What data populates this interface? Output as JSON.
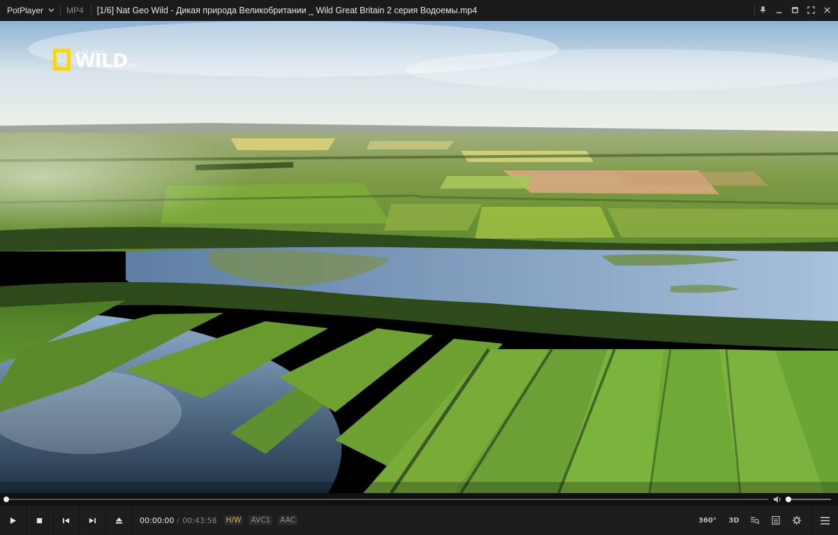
{
  "titlebar": {
    "app_name": "PotPlayer",
    "format": "MP4",
    "title": "[1/6] Nat Geo Wild - Дикая природа Великобритании _ Wild Great Britain 2 серия  Водоемы.mp4"
  },
  "video": {
    "logo": {
      "small_text": "NAT GEO",
      "main_text": "WILD",
      "suffix": "HD",
      "frame_color": "#f6d51a"
    }
  },
  "seek": {
    "progress": 0.0
  },
  "volume": {
    "level": 0.0
  },
  "controls": {
    "current_time": "00:00:00",
    "separator": "/",
    "duration": "00:43:58",
    "hw_badge": "H/W",
    "video_codec": "AVC1",
    "audio_codec": "AAC",
    "btn_360": "360°",
    "btn_3d": "3D"
  },
  "colors": {
    "accent": "#d9b24a",
    "bar_bg": "#1d1d1d",
    "titlebar_bg": "#1b1b1b"
  }
}
